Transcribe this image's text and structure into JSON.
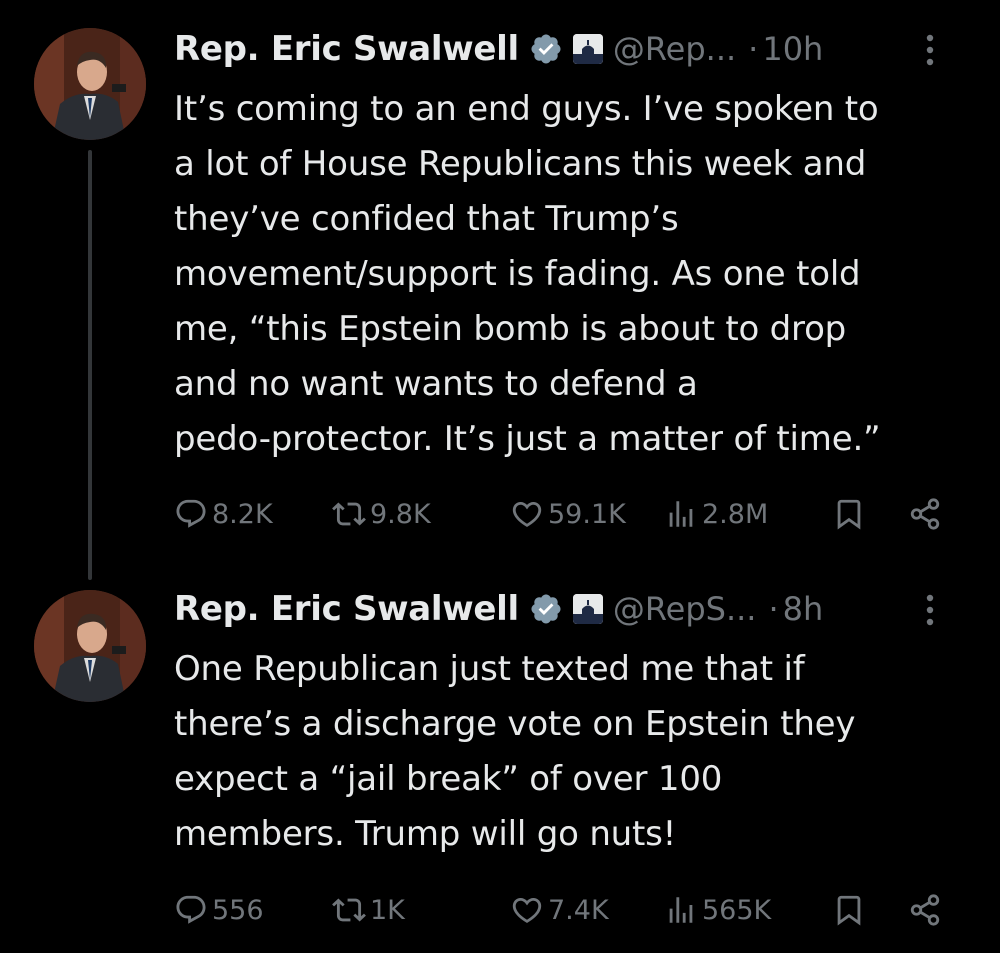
{
  "colors": {
    "background": "#000000",
    "text_primary": "#e7e9ea",
    "text_secondary": "#71767b",
    "verified_badge": "#829aab",
    "thread_line": "#333639"
  },
  "tweets": [
    {
      "author": {
        "name": "Rep. Eric Swalwell",
        "handle": "@Rep...",
        "avatar_icon": "profile-photo"
      },
      "separator": "·",
      "time": "10h",
      "text_lines": [
        "It’s coming to an end guys. I’ve spoken to",
        "a lot of House Republicans this week and",
        "they’ve confided that Trump’s",
        "movement/support is fading. As one told",
        "me, “this Epstein bomb is about to drop",
        "and no want wants to defend a",
        "pedo-protector. It’s just a matter of time.”"
      ],
      "stats": {
        "replies": "8.2K",
        "reposts": "9.8K",
        "likes": "59.1K",
        "views": "2.8M"
      }
    },
    {
      "author": {
        "name": "Rep. Eric Swalwell",
        "handle": "@RepS...",
        "avatar_icon": "profile-photo"
      },
      "separator": "·",
      "time": "8h",
      "text_lines": [
        "One Republican just texted me that if",
        "there’s a discharge vote on Epstein they",
        "expect a “jail break” of over 100",
        "members.  Trump will go nuts!"
      ],
      "stats": {
        "replies": "556",
        "reposts": "1K",
        "likes": "7.4K",
        "views": "565K"
      }
    }
  ]
}
